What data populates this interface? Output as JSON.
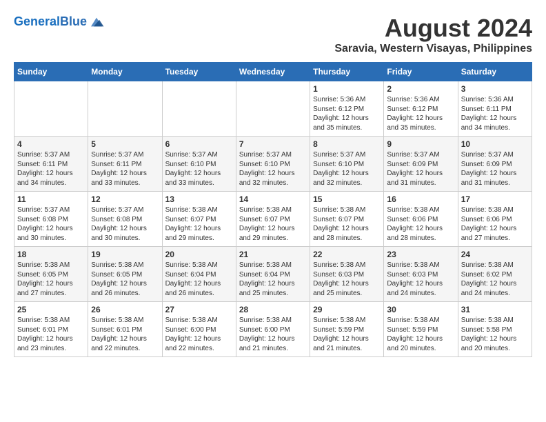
{
  "logo": {
    "line1": "General",
    "line2": "Blue"
  },
  "title": "August 2024",
  "subtitle": "Saravia, Western Visayas, Philippines",
  "weekdays": [
    "Sunday",
    "Monday",
    "Tuesday",
    "Wednesday",
    "Thursday",
    "Friday",
    "Saturday"
  ],
  "weeks": [
    [
      {
        "day": "",
        "info": ""
      },
      {
        "day": "",
        "info": ""
      },
      {
        "day": "",
        "info": ""
      },
      {
        "day": "",
        "info": ""
      },
      {
        "day": "1",
        "info": "Sunrise: 5:36 AM\nSunset: 6:12 PM\nDaylight: 12 hours\nand 35 minutes."
      },
      {
        "day": "2",
        "info": "Sunrise: 5:36 AM\nSunset: 6:12 PM\nDaylight: 12 hours\nand 35 minutes."
      },
      {
        "day": "3",
        "info": "Sunrise: 5:36 AM\nSunset: 6:11 PM\nDaylight: 12 hours\nand 34 minutes."
      }
    ],
    [
      {
        "day": "4",
        "info": "Sunrise: 5:37 AM\nSunset: 6:11 PM\nDaylight: 12 hours\nand 34 minutes."
      },
      {
        "day": "5",
        "info": "Sunrise: 5:37 AM\nSunset: 6:11 PM\nDaylight: 12 hours\nand 33 minutes."
      },
      {
        "day": "6",
        "info": "Sunrise: 5:37 AM\nSunset: 6:10 PM\nDaylight: 12 hours\nand 33 minutes."
      },
      {
        "day": "7",
        "info": "Sunrise: 5:37 AM\nSunset: 6:10 PM\nDaylight: 12 hours\nand 32 minutes."
      },
      {
        "day": "8",
        "info": "Sunrise: 5:37 AM\nSunset: 6:10 PM\nDaylight: 12 hours\nand 32 minutes."
      },
      {
        "day": "9",
        "info": "Sunrise: 5:37 AM\nSunset: 6:09 PM\nDaylight: 12 hours\nand 31 minutes."
      },
      {
        "day": "10",
        "info": "Sunrise: 5:37 AM\nSunset: 6:09 PM\nDaylight: 12 hours\nand 31 minutes."
      }
    ],
    [
      {
        "day": "11",
        "info": "Sunrise: 5:37 AM\nSunset: 6:08 PM\nDaylight: 12 hours\nand 30 minutes."
      },
      {
        "day": "12",
        "info": "Sunrise: 5:37 AM\nSunset: 6:08 PM\nDaylight: 12 hours\nand 30 minutes."
      },
      {
        "day": "13",
        "info": "Sunrise: 5:38 AM\nSunset: 6:07 PM\nDaylight: 12 hours\nand 29 minutes."
      },
      {
        "day": "14",
        "info": "Sunrise: 5:38 AM\nSunset: 6:07 PM\nDaylight: 12 hours\nand 29 minutes."
      },
      {
        "day": "15",
        "info": "Sunrise: 5:38 AM\nSunset: 6:07 PM\nDaylight: 12 hours\nand 28 minutes."
      },
      {
        "day": "16",
        "info": "Sunrise: 5:38 AM\nSunset: 6:06 PM\nDaylight: 12 hours\nand 28 minutes."
      },
      {
        "day": "17",
        "info": "Sunrise: 5:38 AM\nSunset: 6:06 PM\nDaylight: 12 hours\nand 27 minutes."
      }
    ],
    [
      {
        "day": "18",
        "info": "Sunrise: 5:38 AM\nSunset: 6:05 PM\nDaylight: 12 hours\nand 27 minutes."
      },
      {
        "day": "19",
        "info": "Sunrise: 5:38 AM\nSunset: 6:05 PM\nDaylight: 12 hours\nand 26 minutes."
      },
      {
        "day": "20",
        "info": "Sunrise: 5:38 AM\nSunset: 6:04 PM\nDaylight: 12 hours\nand 26 minutes."
      },
      {
        "day": "21",
        "info": "Sunrise: 5:38 AM\nSunset: 6:04 PM\nDaylight: 12 hours\nand 25 minutes."
      },
      {
        "day": "22",
        "info": "Sunrise: 5:38 AM\nSunset: 6:03 PM\nDaylight: 12 hours\nand 25 minutes."
      },
      {
        "day": "23",
        "info": "Sunrise: 5:38 AM\nSunset: 6:03 PM\nDaylight: 12 hours\nand 24 minutes."
      },
      {
        "day": "24",
        "info": "Sunrise: 5:38 AM\nSunset: 6:02 PM\nDaylight: 12 hours\nand 24 minutes."
      }
    ],
    [
      {
        "day": "25",
        "info": "Sunrise: 5:38 AM\nSunset: 6:01 PM\nDaylight: 12 hours\nand 23 minutes."
      },
      {
        "day": "26",
        "info": "Sunrise: 5:38 AM\nSunset: 6:01 PM\nDaylight: 12 hours\nand 22 minutes."
      },
      {
        "day": "27",
        "info": "Sunrise: 5:38 AM\nSunset: 6:00 PM\nDaylight: 12 hours\nand 22 minutes."
      },
      {
        "day": "28",
        "info": "Sunrise: 5:38 AM\nSunset: 6:00 PM\nDaylight: 12 hours\nand 21 minutes."
      },
      {
        "day": "29",
        "info": "Sunrise: 5:38 AM\nSunset: 5:59 PM\nDaylight: 12 hours\nand 21 minutes."
      },
      {
        "day": "30",
        "info": "Sunrise: 5:38 AM\nSunset: 5:59 PM\nDaylight: 12 hours\nand 20 minutes."
      },
      {
        "day": "31",
        "info": "Sunrise: 5:38 AM\nSunset: 5:58 PM\nDaylight: 12 hours\nand 20 minutes."
      }
    ]
  ]
}
